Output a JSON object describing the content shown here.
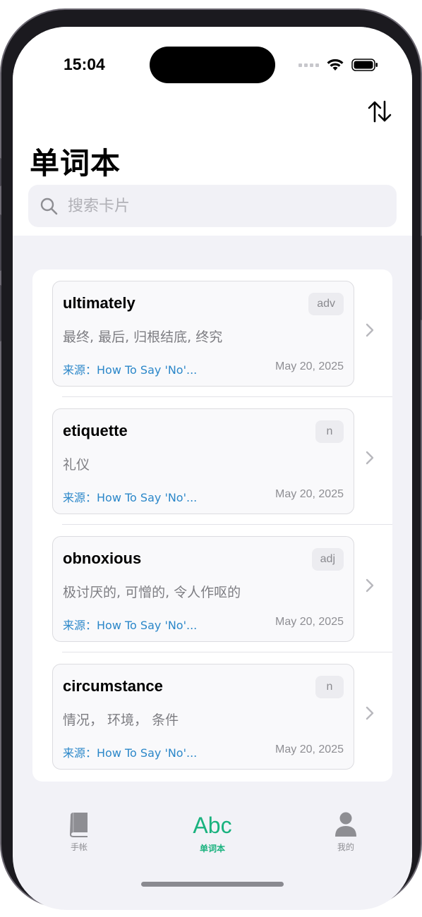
{
  "status_bar": {
    "time": "15:04"
  },
  "header": {
    "title": "单词本",
    "sort_icon": "sort-arrows-icon"
  },
  "search": {
    "placeholder": "搜索卡片",
    "value": ""
  },
  "words": [
    {
      "word": "ultimately",
      "pos": "adv",
      "meaning": "最终, 最后, 归根结底, 终究",
      "source": "来源：How To Say 'No'...",
      "date": "May 20, 2025"
    },
    {
      "word": "etiquette",
      "pos": "n",
      "meaning": "礼仪",
      "source": "来源：How To Say 'No'...",
      "date": "May 20, 2025"
    },
    {
      "word": "obnoxious",
      "pos": "adj",
      "meaning": "极讨厌的, 可憎的, 令人作呕的",
      "source": "来源：How To Say 'No'...",
      "date": "May 20, 2025"
    },
    {
      "word": "circumstance",
      "pos": "n",
      "meaning": "情况， 环境， 条件",
      "source": "来源：How To Say 'No'...",
      "date": "May 20, 2025"
    }
  ],
  "tab_bar": {
    "tabs": [
      {
        "label": "手帐",
        "icon": "book-icon",
        "active": false
      },
      {
        "label": "单词本",
        "icon": "Abc",
        "active": true
      },
      {
        "label": "我的",
        "icon": "person-icon",
        "active": false
      }
    ]
  },
  "colors": {
    "accent": "#19b27e",
    "source_link": "#2b87c9",
    "background": "#f2f2f7"
  }
}
